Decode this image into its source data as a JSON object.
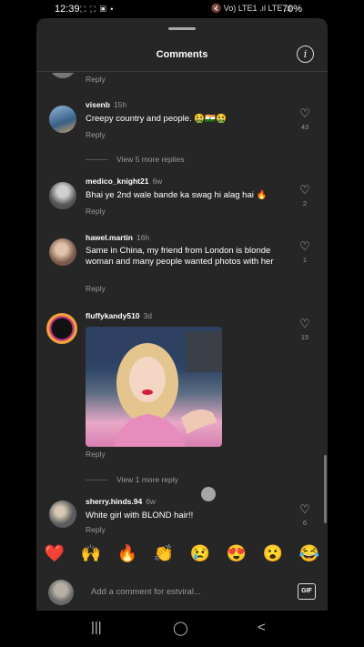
{
  "status": {
    "time": "12:39",
    "notif_icons": "⛶ ⛶ ▣ •",
    "signal_icons": "🔇 Vo) LTE1 .ıl LTE .ıl",
    "battery": "70%"
  },
  "header": {
    "title": "Comments",
    "info_glyph": "i"
  },
  "comments": [
    {
      "reply": "Reply"
    },
    {
      "username": "visenb",
      "age": "15h",
      "text": "Creepy country and people. 🤮🇮🇳🤮",
      "reply": "Reply",
      "likes": "43"
    },
    {
      "view_more": "View 5 more replies"
    },
    {
      "username": "medico_knight21",
      "age": "6w",
      "text": "Bhai ye 2nd wale bande ka swag hi alag hai 🔥",
      "reply": "Reply",
      "likes": "2"
    },
    {
      "username": "hawel.martin",
      "age": "16h",
      "text": "Same in China, my friend from London is blonde woman and many people wanted photos with her",
      "reply": "Reply",
      "likes": "1"
    },
    {
      "username": "fluffykandy510",
      "age": "3d",
      "reply": "Reply",
      "likes": "15"
    },
    {
      "view_more": "View 1 more reply"
    },
    {
      "username": "sherry.hinds.94",
      "age": "6w",
      "text": "White girl with BLOND hair!!",
      "reply": "Reply",
      "likes": "6"
    }
  ],
  "emoji_bar": [
    "❤️",
    "🙌",
    "🔥",
    "👏",
    "😢",
    "😍",
    "😮",
    "😂"
  ],
  "composer": {
    "placeholder": "Add a comment for estviral...",
    "gif_label": "GIF"
  },
  "nav": {
    "recents": "|||",
    "home": "◯",
    "back": "<"
  }
}
